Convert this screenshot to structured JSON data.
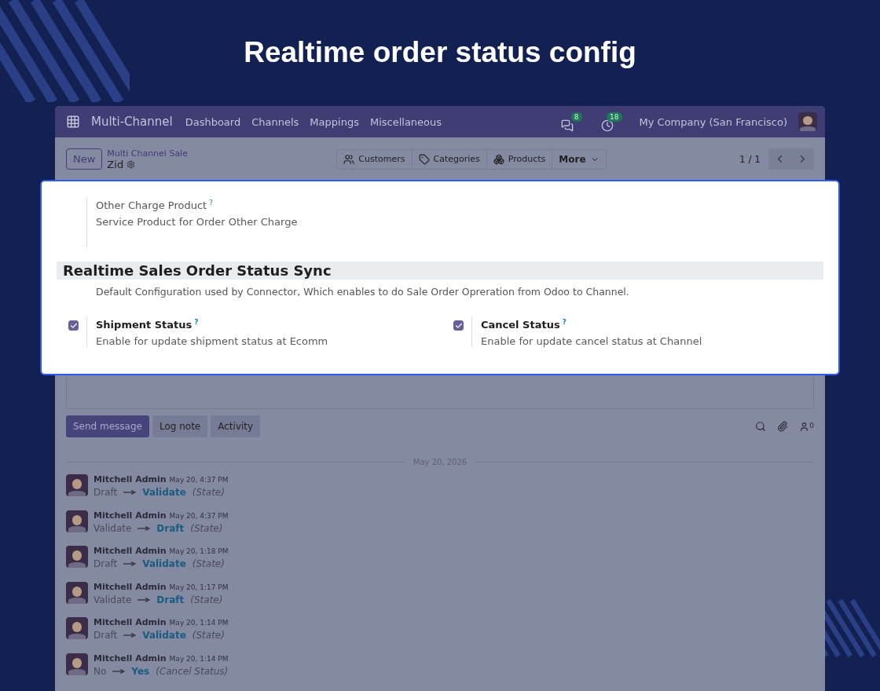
{
  "heading": "Realtime order status config",
  "navbar": {
    "app": "Multi-Channel",
    "menu": [
      "Dashboard",
      "Channels",
      "Mappings",
      "Miscellaneous"
    ],
    "messages_badge": "8",
    "activities_badge": "18",
    "company": "My Company (San Francisco)"
  },
  "control_panel": {
    "new_button": "New",
    "breadcrumb": "Multi Channel Sale",
    "record": "Zid",
    "smart_buttons": [
      {
        "kind": "users",
        "label": "Customers"
      },
      {
        "kind": "tag",
        "label": "Categories"
      },
      {
        "kind": "boxes",
        "label": "Products"
      }
    ],
    "more": "More",
    "pager": "1 / 1"
  },
  "settings_card": {
    "field": {
      "label": "Other Charge Product",
      "help": "?",
      "description": "Service Product for Order Other Charge"
    },
    "section_title": "Realtime Sales Order Status Sync",
    "section_description": "Default Configuration used by Connector, Which enables to do Sale Order Opreration from Odoo to Channel.",
    "options": [
      {
        "label": "Shipment Status",
        "help": "?",
        "description": "Enable for update shipment status at Ecomm",
        "checked": true
      },
      {
        "label": "Cancel Status",
        "help": "?",
        "description": "Enable for update cancel status at Channel",
        "checked": true
      }
    ]
  },
  "chatter": {
    "buttons": [
      {
        "label": "Send message",
        "selected": true
      },
      {
        "label": "Log note",
        "selected": false
      },
      {
        "label": "Activity",
        "selected": false
      }
    ],
    "followers": "0",
    "date": "May 20, 2026",
    "messages": [
      {
        "author": "Mitchell Admin",
        "time": "May 20, 4:37 PM",
        "old": "Draft",
        "new": "Validate",
        "field": "(State)"
      },
      {
        "author": "Mitchell Admin",
        "time": "May 20, 4:37 PM",
        "old": "Validate",
        "new": "Draft",
        "field": "(State)"
      },
      {
        "author": "Mitchell Admin",
        "time": "May 20, 1:18 PM",
        "old": "Draft",
        "new": "Validate",
        "field": "(State)"
      },
      {
        "author": "Mitchell Admin",
        "time": "May 20, 1:17 PM",
        "old": "Validate",
        "new": "Draft",
        "field": "(State)"
      },
      {
        "author": "Mitchell Admin",
        "time": "May 20, 1:14 PM",
        "old": "Draft",
        "new": "Validate",
        "field": "(State)"
      },
      {
        "author": "Mitchell Admin",
        "time": "May 20, 1:14 PM",
        "old": "No",
        "new": "Yes",
        "field": "(Cancel Status)"
      }
    ]
  }
}
